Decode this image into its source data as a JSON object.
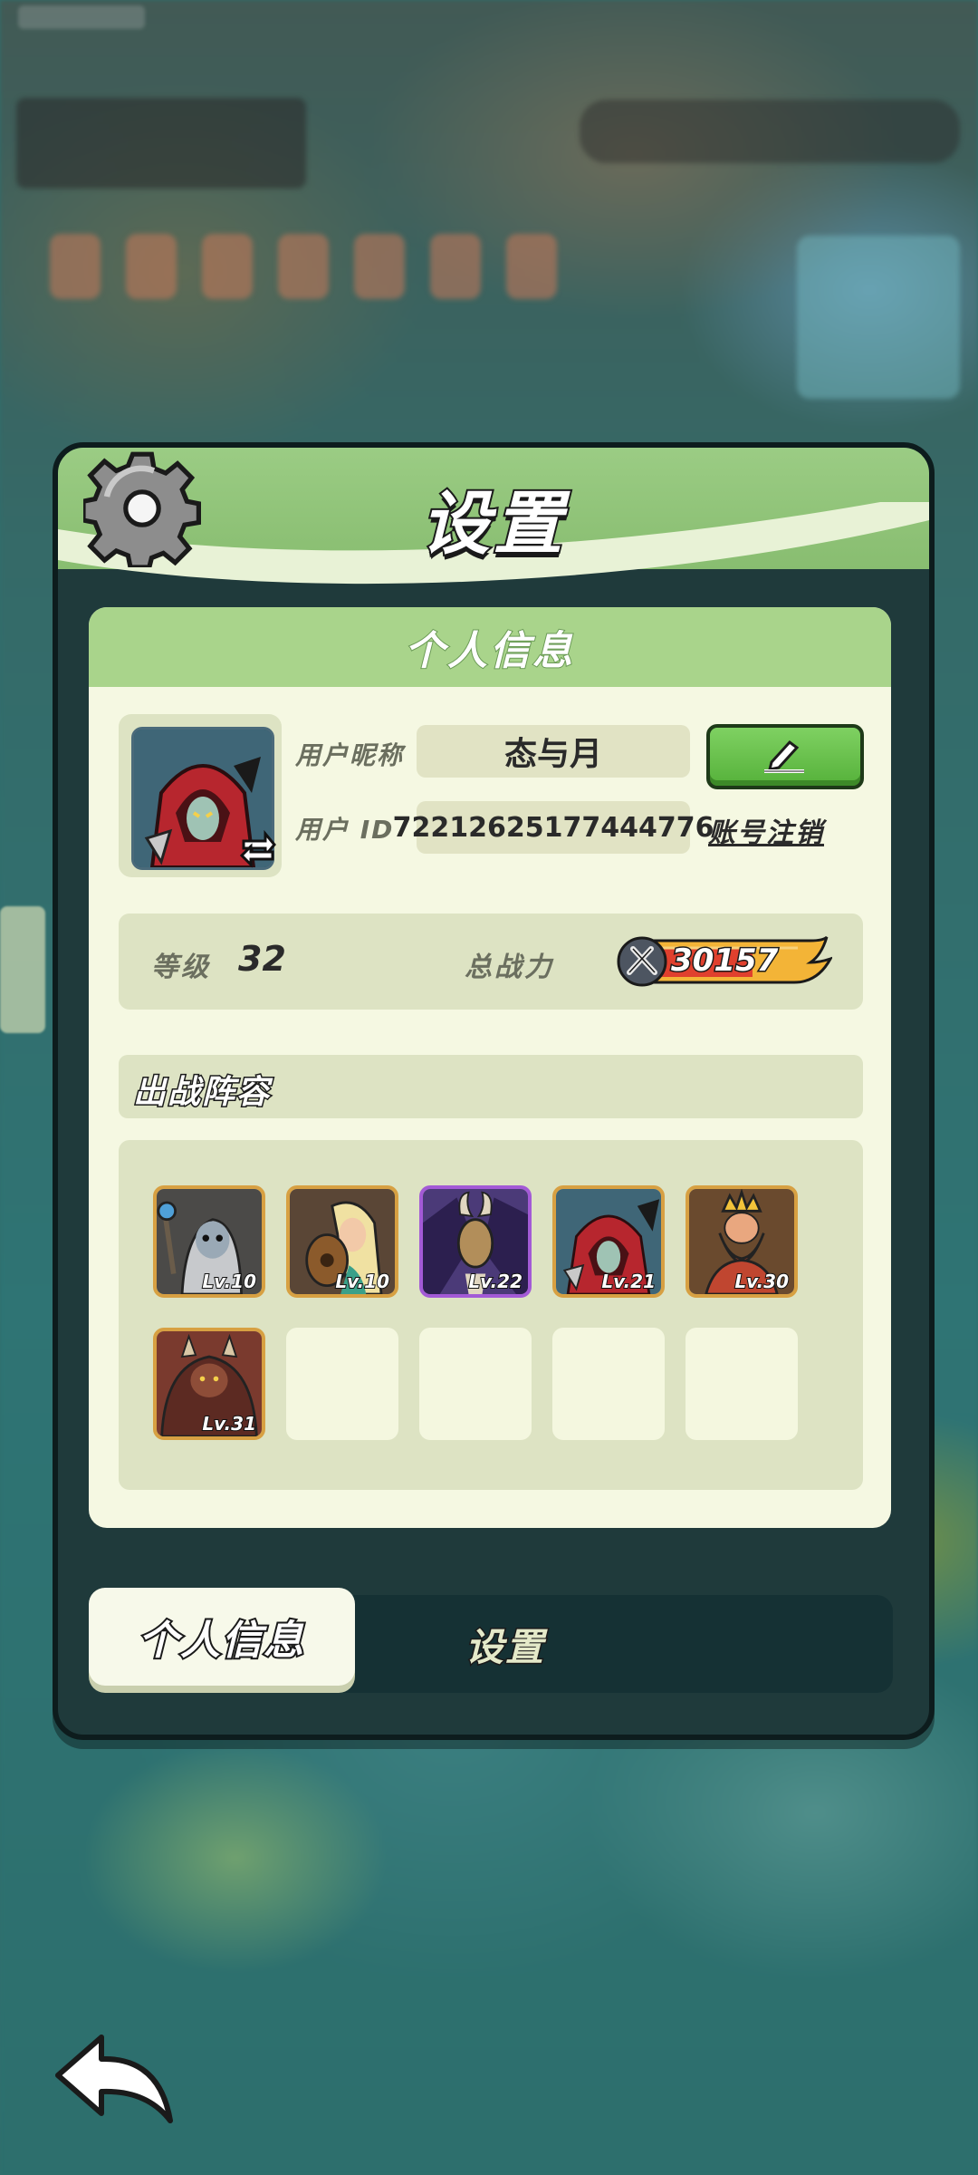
{
  "window": {
    "title": "设置"
  },
  "panel": {
    "title": "个人信息"
  },
  "profile": {
    "nickname_label": "用户昵称",
    "nickname": "态与月",
    "id_label": "用户 ID",
    "user_id": "72212625177444776",
    "account_cancel_label": "账号注销"
  },
  "stats": {
    "level_label": "等级",
    "level": "32",
    "power_label": "总战力",
    "power": "30157"
  },
  "lineup": {
    "title": "出战阵容",
    "heroes": [
      {
        "level": "Lv.10",
        "rarity": "rare"
      },
      {
        "level": "Lv.10",
        "rarity": "rare"
      },
      {
        "level": "Lv.22",
        "rarity": "epic"
      },
      {
        "level": "Lv.21",
        "rarity": "rare"
      },
      {
        "level": "Lv.30",
        "rarity": "rare"
      },
      {
        "level": "Lv.31",
        "rarity": "rare"
      }
    ],
    "total_slots": 10
  },
  "tabs": {
    "active": "个人信息",
    "inactive": "设置"
  },
  "colors": {
    "header_green": "#9bcc84",
    "panel_bg": "#f5f8e2",
    "edit_button": "#55b13a",
    "rare_border": "#d7a042",
    "epic_border": "#a35ad6"
  }
}
